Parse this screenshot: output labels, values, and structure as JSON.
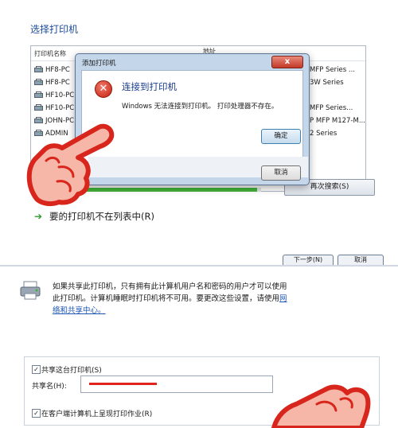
{
  "wizard": {
    "title": "选择打印机",
    "columns": [
      "打印机名称",
      "地址"
    ],
    "printers": [
      {
        "name": "HF8-PC",
        "address": "MFP Series ..."
      },
      {
        "name": "HF8-PC",
        "address": "3W Series"
      },
      {
        "name": "HF10-PC",
        "address": ""
      },
      {
        "name": "HF10-PC",
        "address": "MFP Series..."
      },
      {
        "name": "JOHN-PC",
        "address": "P MFP M127-M..."
      },
      {
        "name": "ADMIN",
        "address": "2 Series"
      }
    ],
    "search_again_button": "再次搜索(S)",
    "not_listed_link": "要的打印机不在列表中(R)",
    "next_button": "下一步(N)",
    "cancel_button": "取消",
    "progress": 0.98
  },
  "dialog": {
    "title": "添加打印机",
    "heading": "连接到打印机",
    "message": "Windows 无法连接到打印机。 打印处理器不存在。",
    "ok_button": "确定",
    "cancel_button": "取消"
  },
  "sharing": {
    "description": "如果共享此打印机，只有拥有此计算机用户名和密码的用户才可以使用此打印机。计算机睡眠时打印机将不可用。要更改这些设置，请使用",
    "link": "网络和共享中心。",
    "share_checkbox_label": "共享这台打印机(S)",
    "share_name_label": "共享名(H):",
    "render_checkbox_label": "在客户端计算机上呈现打印作业(R)"
  },
  "colors": {
    "accent_blue": "#1c4c9c",
    "progress_green": "#44b33a",
    "error_red": "#c2200f",
    "annotation_red": "#e0231b"
  }
}
